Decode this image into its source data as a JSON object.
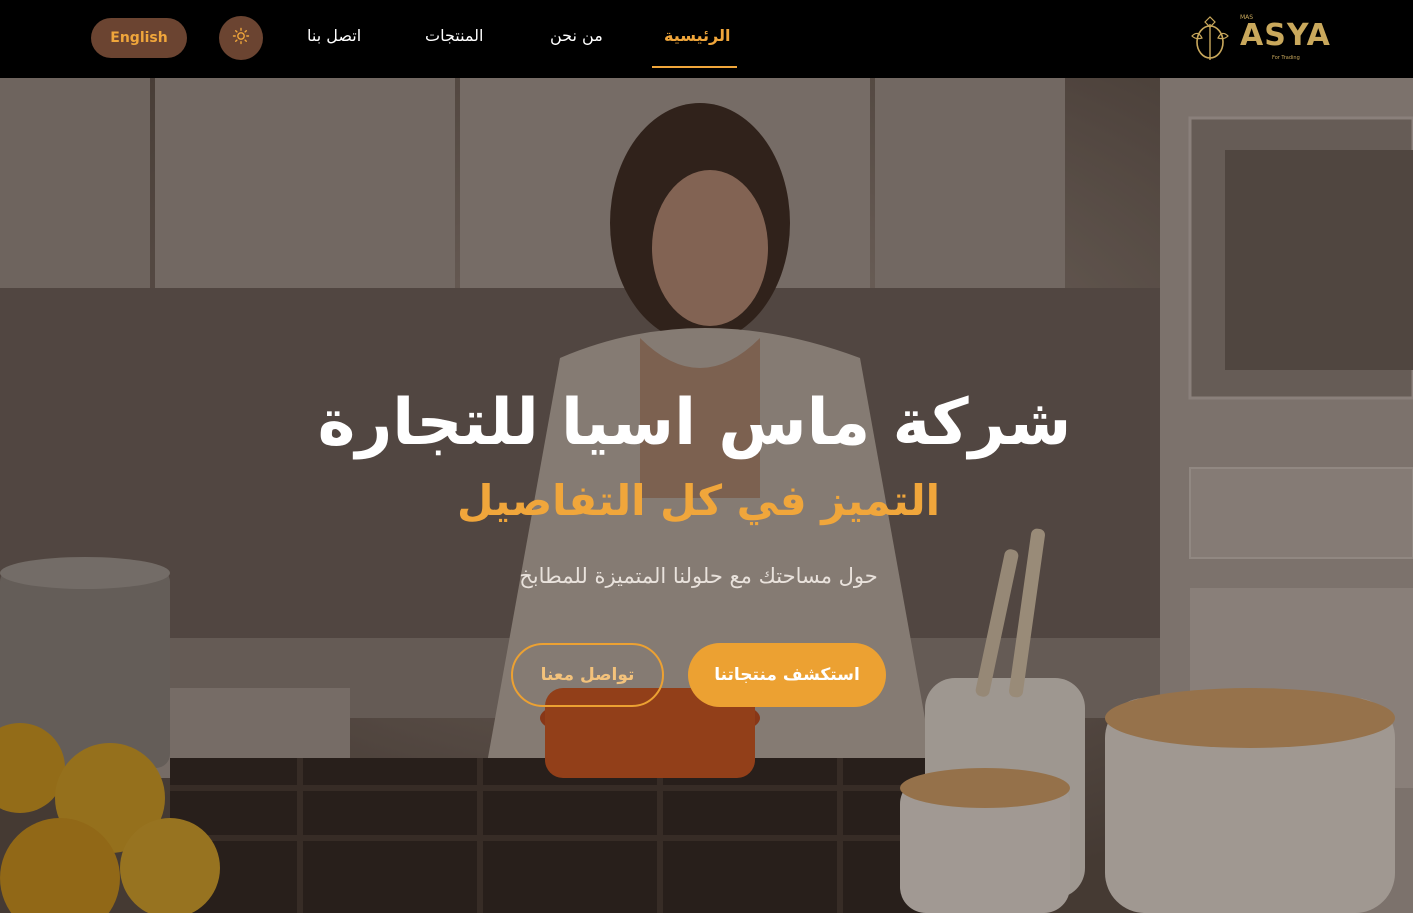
{
  "nav": {
    "language_button": "English",
    "theme_toggle_icon": "sun-icon",
    "items": [
      {
        "label": "الرئيسية",
        "active": true
      },
      {
        "label": "من نحن",
        "active": false
      },
      {
        "label": "المنتجات",
        "active": false
      },
      {
        "label": "اتصل بنا",
        "active": false
      }
    ],
    "logo": {
      "small": "MAS",
      "main": "ASYA",
      "sub": "For Trading"
    }
  },
  "hero": {
    "title": "شركة ماس اسيا للتجارة",
    "subtitle": "التميز في كل التفاصيل",
    "description": "حول مساحتك مع حلولنا المتميزة للمطابخ",
    "primary_button": "استكشف منتجاتنا",
    "secondary_button": "تواصل معنا"
  },
  "colors": {
    "accent": "#f0a63b",
    "button_fill": "#eca132",
    "nav_background": "#000000",
    "language_button_bg": "#6b4431"
  }
}
